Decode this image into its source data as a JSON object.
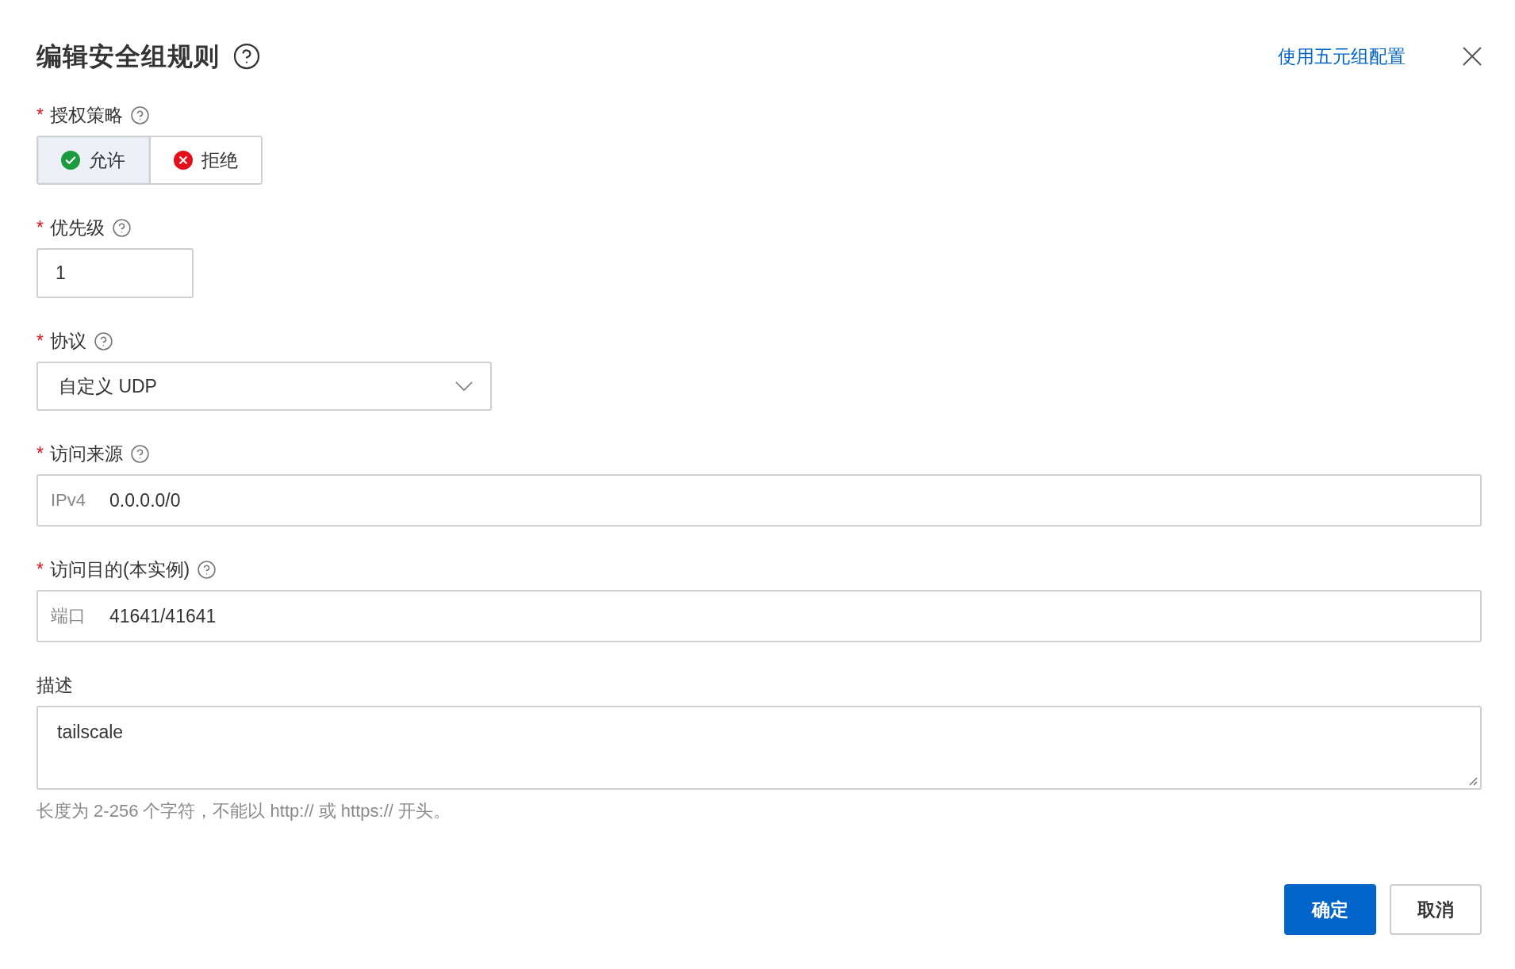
{
  "dialog": {
    "title": "编辑安全组规则",
    "help": true,
    "link": "使用五元组配置"
  },
  "fields": [
    {
      "kind": "segmented",
      "label": "授权策略",
      "required_mark": "*",
      "help": true,
      "options": [
        {
          "label": "允许",
          "kind": "allow",
          "color": "#1c9b3e",
          "selected": true
        },
        {
          "label": "拒绝",
          "kind": "deny",
          "color": "#e3101b",
          "selected": false
        }
      ]
    },
    {
      "kind": "input",
      "label": "优先级",
      "required_mark": "*",
      "help": true,
      "value": "1"
    },
    {
      "kind": "select",
      "label": "协议",
      "required_mark": "*",
      "help": true,
      "value": "自定义 UDP"
    },
    {
      "kind": "prefixed_input",
      "label": "访问来源",
      "required_mark": "*",
      "help": true,
      "prefix": "IPv4",
      "value": "0.0.0.0/0"
    },
    {
      "kind": "prefixed_input",
      "label": "访问目的(本实例)",
      "required_mark": "*",
      "help": true,
      "prefix": "端口",
      "value": "41641/41641"
    },
    {
      "kind": "textarea",
      "label": "描述",
      "help": false,
      "value": "tailscale",
      "hint": "长度为 2-256 个字符，不能以 http:// 或 https:// 开头。"
    }
  ],
  "buttons": [
    {
      "label": "确定",
      "kind": "primary"
    },
    {
      "label": "取消",
      "kind": "default"
    }
  ]
}
